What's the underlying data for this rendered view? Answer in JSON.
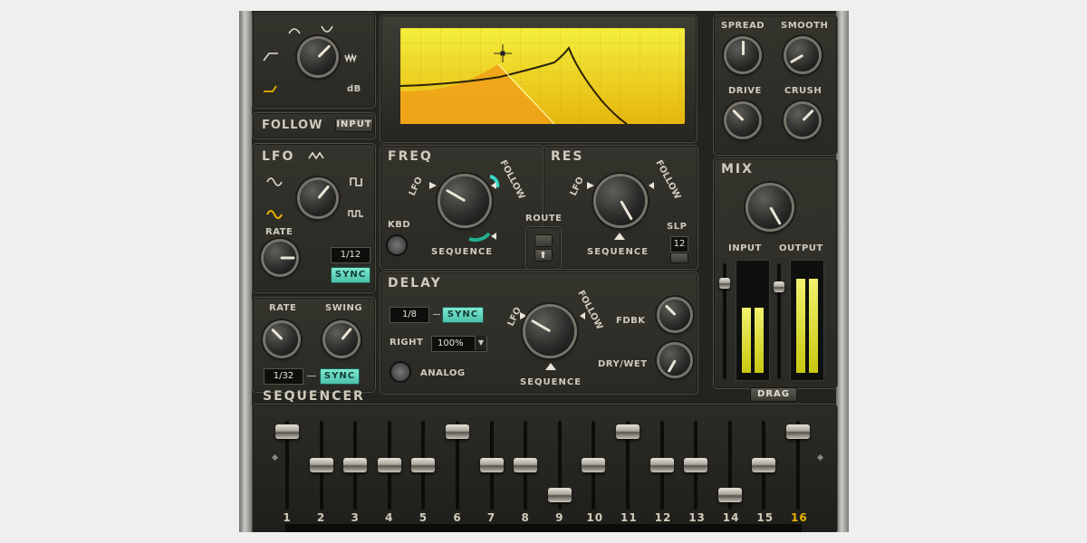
{
  "filter_type": {
    "follow_label": "FOLLOW",
    "input_button": "INPUT",
    "db_label": "dB"
  },
  "lfo": {
    "title": "LFO",
    "rate_label": "RATE",
    "rate_value": "1/12",
    "sync_label": "SYNC"
  },
  "seq_clock": {
    "rate_label": "RATE",
    "swing_label": "SWING",
    "rate_value": "1/32",
    "sync_label": "SYNC"
  },
  "freq": {
    "title": "FREQ",
    "lfo_label": "LFO",
    "follow_label": "FOLLOW",
    "sequence_label": "SEQUENCE",
    "kbd_label": "KBD"
  },
  "res": {
    "title": "RES",
    "lfo_label": "LFO",
    "follow_label": "FOLLOW",
    "sequence_label": "SEQUENCE",
    "slope_label": "SLP",
    "slope_value": "12"
  },
  "route": {
    "label": "ROUTE"
  },
  "delay": {
    "title": "DELAY",
    "time_value": "1/8",
    "sync_label": "SYNC",
    "right_label": "RIGHT",
    "right_value": "100%",
    "analog_label": "ANALOG",
    "lfo_label": "LFO",
    "follow_label": "FOLLOW",
    "sequence_label": "SEQUENCE",
    "feedback_label": "FDBK",
    "drywet_label": "DRY/WET"
  },
  "fx": {
    "spread_label": "SPREAD",
    "smooth_label": "SMOOTH",
    "drive_label": "DRIVE",
    "crush_label": "CRUSH"
  },
  "mix": {
    "title": "MIX",
    "input_label": "INPUT",
    "output_label": "OUTPUT",
    "input_level": 0.62,
    "output_level": 0.9
  },
  "sequencer": {
    "title": "SEQUENCER",
    "drag_label": "DRAG",
    "active_step": "16",
    "steps": [
      "1",
      "2",
      "3",
      "4",
      "5",
      "6",
      "7",
      "8",
      "9",
      "10",
      "11",
      "12",
      "13",
      "14",
      "15",
      "16"
    ],
    "step_values": [
      0.95,
      0.5,
      0.5,
      0.5,
      0.5,
      0.95,
      0.5,
      0.5,
      0.1,
      0.5,
      0.95,
      0.5,
      0.5,
      0.1,
      0.5,
      0.95
    ]
  },
  "colors": {
    "accent_teal": "#4bc0a8",
    "accent_yellow": "#e8b300",
    "screen": "#f2d21a"
  }
}
